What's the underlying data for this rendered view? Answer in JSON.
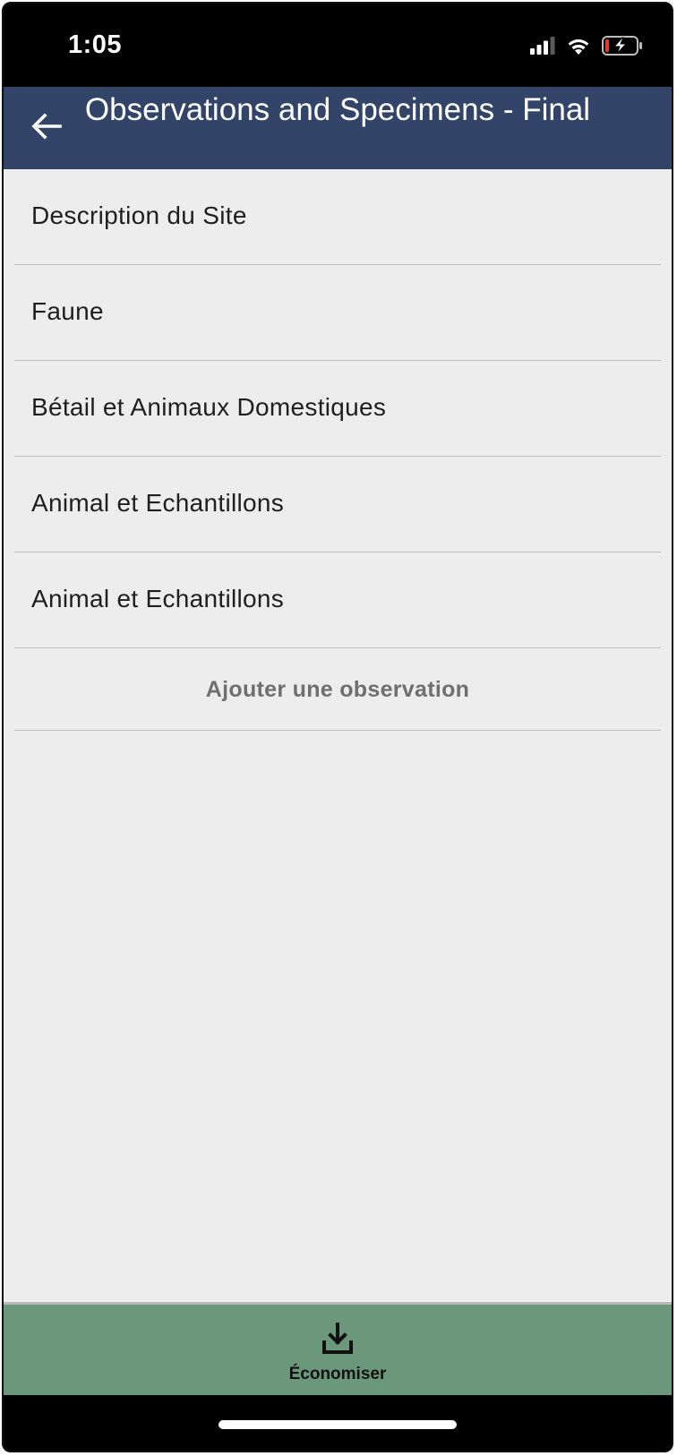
{
  "status_bar": {
    "time": "1:05",
    "icons": [
      "cellular-signal-icon",
      "wifi-icon",
      "battery-charging-icon"
    ]
  },
  "header": {
    "back_icon": "arrow-left-icon",
    "title": "Observations and Specimens - Final"
  },
  "list": {
    "items": [
      {
        "label": "Description du Site"
      },
      {
        "label": "Faune"
      },
      {
        "label": "Bétail et Animaux Domestiques"
      },
      {
        "label": "Animal et Echantillons"
      },
      {
        "label": "Animal et Echantillons"
      }
    ],
    "add_label": "Ajouter une observation"
  },
  "bottom_bar": {
    "save_icon": "download-tray-icon",
    "save_label": "Économiser"
  },
  "colors": {
    "header_bg": "#324568",
    "content_bg": "#ededed",
    "save_bar_bg": "#6b987a",
    "battery_low": "#e53935"
  }
}
